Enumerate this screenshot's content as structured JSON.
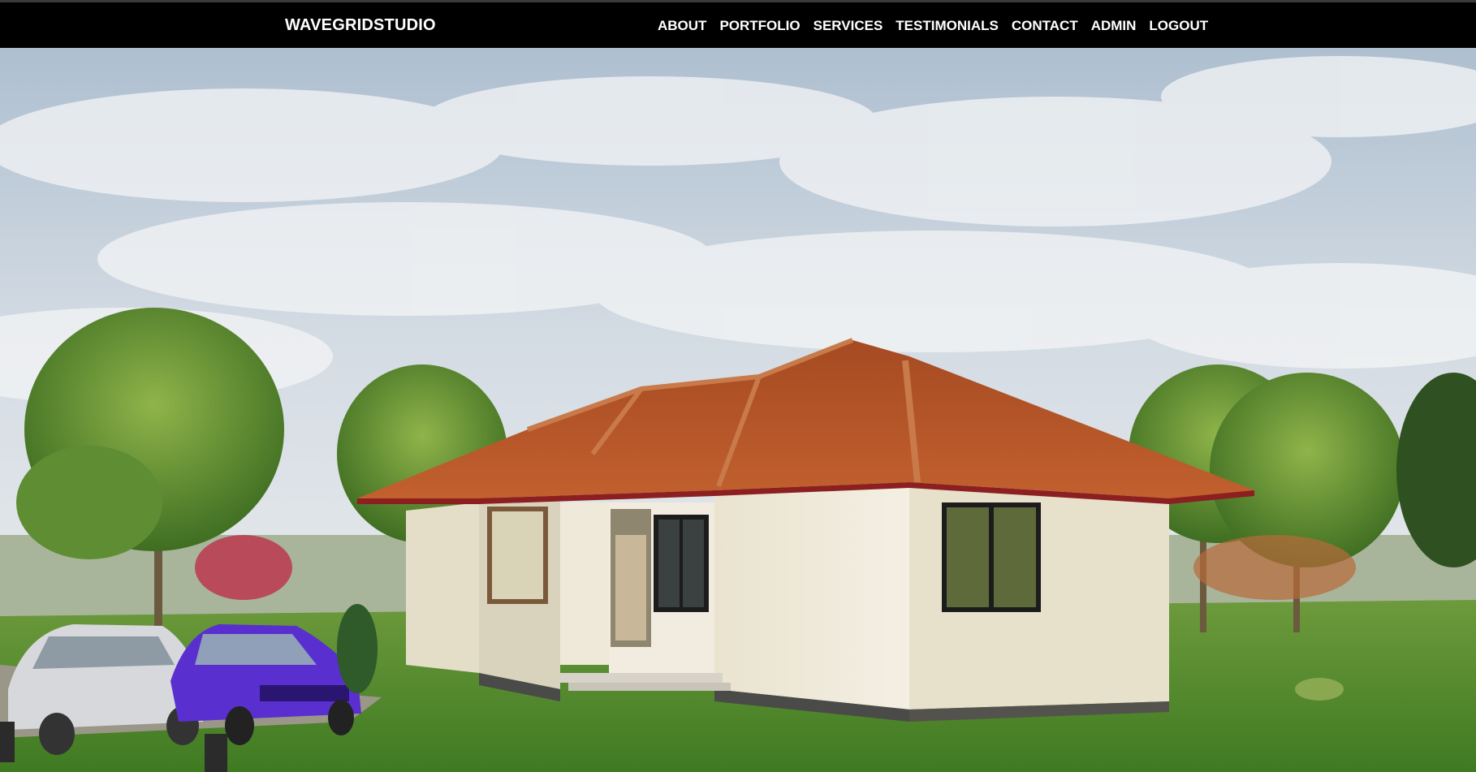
{
  "site": {
    "brand": "WAVEGRIDSTUDIO"
  },
  "nav": {
    "items": [
      {
        "label": "ABOUT",
        "name": "nav-about"
      },
      {
        "label": "PORTFOLIO",
        "name": "nav-portfolio"
      },
      {
        "label": "SERVICES",
        "name": "nav-services"
      },
      {
        "label": "TESTIMONIALS",
        "name": "nav-testimonials"
      },
      {
        "label": "CONTACT",
        "name": "nav-contact"
      },
      {
        "label": "ADMIN",
        "name": "nav-admin"
      },
      {
        "label": "LOGOUT",
        "name": "nav-logout"
      }
    ]
  },
  "colors": {
    "nav_bg": "#000000",
    "nav_text": "#ffffff",
    "roof": "#b4572a",
    "wall": "#ece6d2",
    "lawn": "#4f8a2a",
    "sky": "#c9d6e3"
  }
}
